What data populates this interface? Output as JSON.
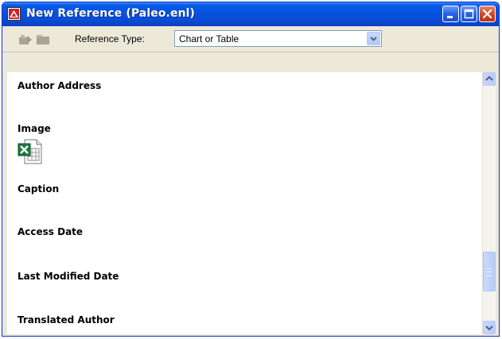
{
  "window": {
    "title": "New Reference (Paleo.enl)",
    "app_icon": "endnote-icon",
    "controls": [
      "minimize-icon",
      "maximize-icon",
      "close-icon"
    ]
  },
  "toolbar": {
    "icons": [
      "tool-move-icon",
      "tool-folder-icon"
    ],
    "reference_type_label": "Reference Type:",
    "reference_type_value": "Chart or Table"
  },
  "fields": [
    {
      "label": "Author Address"
    },
    {
      "label": "Image",
      "attachment_icon": "excel-file-icon"
    },
    {
      "label": "Caption"
    },
    {
      "label": "Access Date"
    },
    {
      "label": "Last Modified Date"
    },
    {
      "label": "Translated Author"
    }
  ],
  "colors": {
    "title_bar": "#0a4cd6",
    "window_bg": "#ece9d8",
    "content_bg": "#ffffff",
    "close_button": "#d24a25"
  }
}
